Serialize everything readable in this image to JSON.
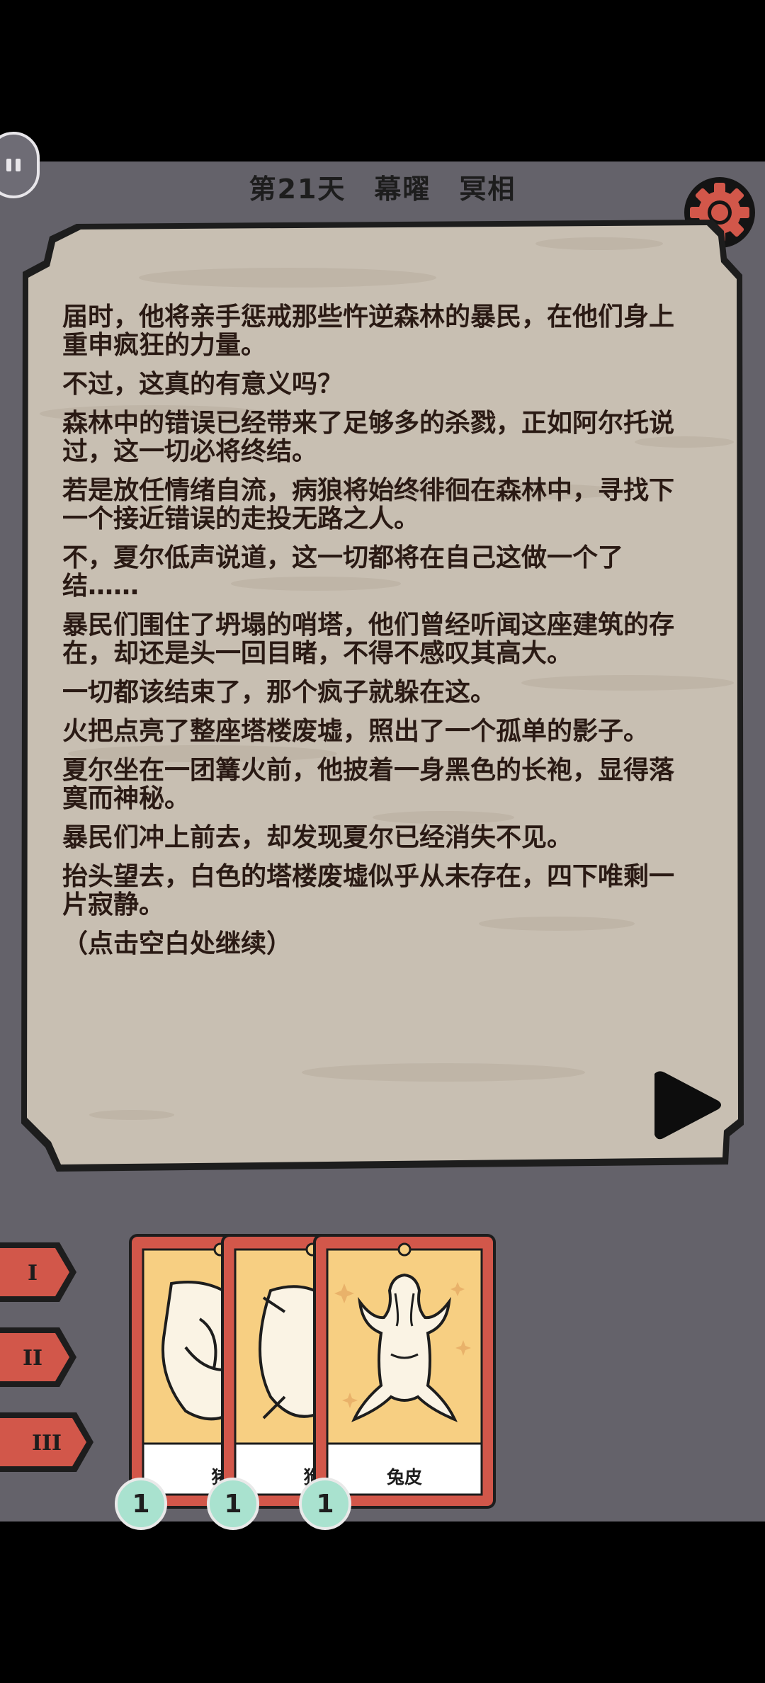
{
  "header": {
    "title": "第21天　幕曜　冥相"
  },
  "story": {
    "paragraphs": [
      "届时，他将亲手惩戒那些忤逆森林的暴民，在他们身上重申疯狂的力量。",
      "不过，这真的有意义吗？",
      "森林中的错误已经带来了足够多的杀戮，正如阿尔托说过，这一切必将终结。",
      "若是放任情绪自流，病狼将始终徘徊在森林中，寻找下一个接近错误的走投无路之人。",
      "不，夏尔低声说道，这一切都将在自己这做一个了结……",
      "暴民们围住了坍塌的哨塔，他们曾经听闻这座建筑的存在，却还是头一回目睹，不得不感叹其高大。",
      "一切都该结束了，那个疯子就躲在这。",
      "火把点亮了整座塔楼废墟，照出了一个孤单的影子。",
      "夏尔坐在一团篝火前，他披着一身黑色的长袍，显得落寞而神秘。",
      "暴民们冲上前去，却发现夏尔已经消失不见。",
      "抬头望去，白色的塔楼废墟似乎从未存在，四下唯剩一片寂静。"
    ],
    "continue_hint": "（点击空白处继续）"
  },
  "level_tabs": [
    "I",
    "II",
    "III"
  ],
  "cards": [
    {
      "label": "猪",
      "count": "1",
      "icon": "pig-pelt-icon"
    },
    {
      "label": "狗",
      "count": "1",
      "icon": "dog-pelt-icon"
    },
    {
      "label": "兔皮",
      "count": "1",
      "icon": "rabbit-pelt-icon"
    }
  ],
  "colors": {
    "background": "#64626a",
    "paper": "#c8bfb2",
    "card_frame": "#d2574a",
    "card_art": "#f7cf82",
    "badge": "#a9e2cf",
    "text": "#2a1a14"
  }
}
